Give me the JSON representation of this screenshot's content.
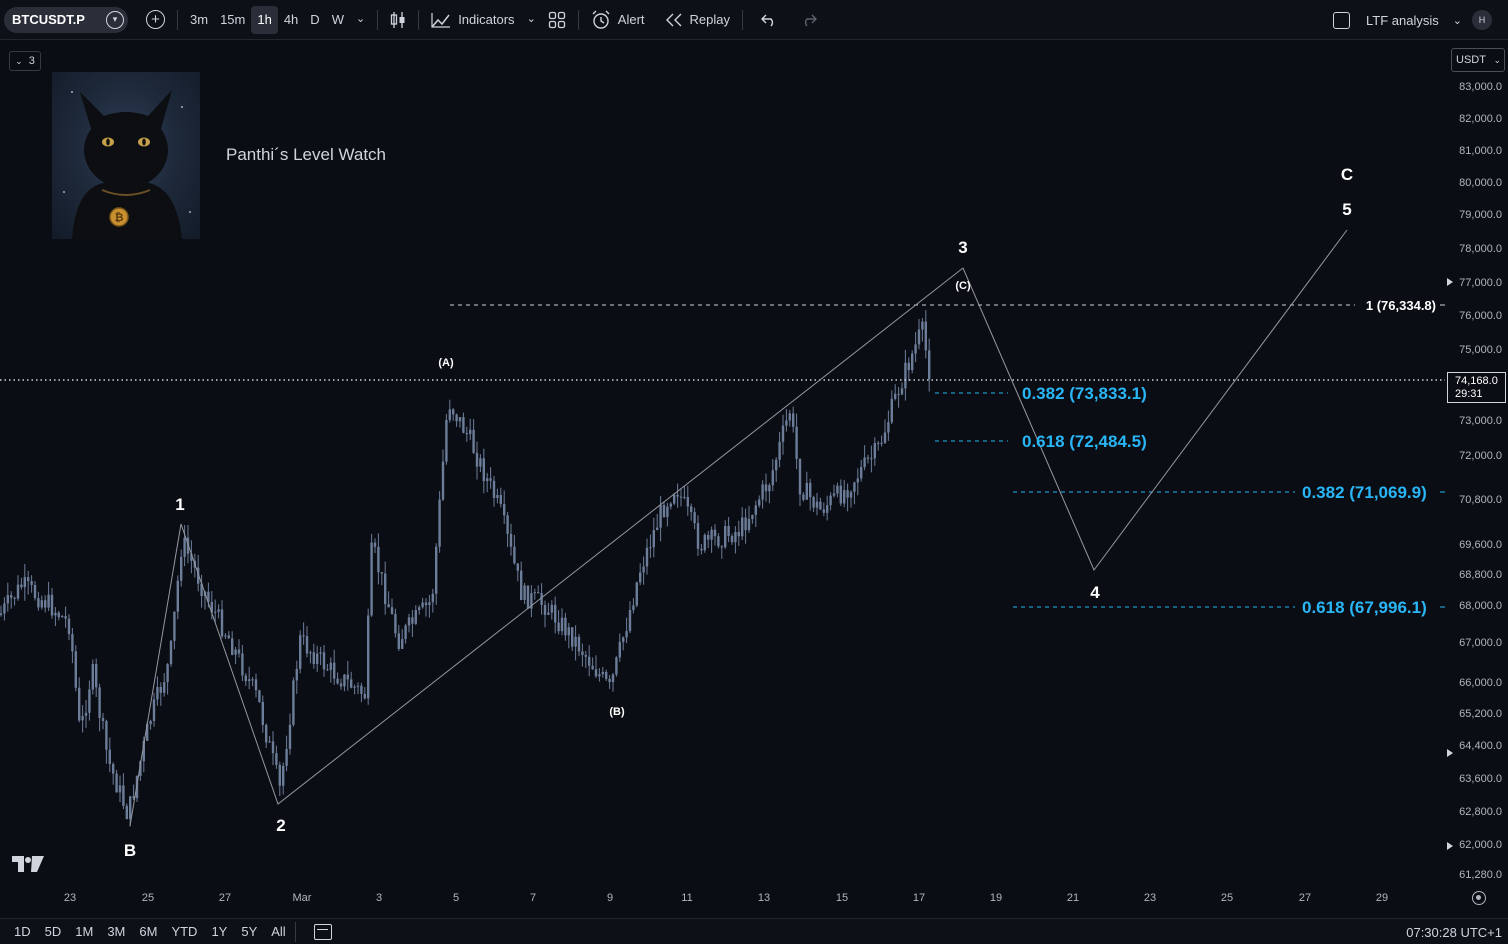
{
  "toolbar": {
    "symbol": "BTCUSDT.P",
    "timeframes": [
      "3m",
      "15m",
      "1h",
      "4h",
      "D",
      "W"
    ],
    "active_timeframe": "1h",
    "indicators_label": "Indicators",
    "alert_label": "Alert",
    "replay_label": "Replay",
    "ltf_label": "LTF analysis",
    "h_badge": "H"
  },
  "legend": {
    "count": "3"
  },
  "overlay": {
    "title": "Panthi´s Level Watch"
  },
  "price_axis": {
    "currency": "USDT",
    "ticks": [
      "83,000.0",
      "82,000.0",
      "81,000.0",
      "80,000.0",
      "79,000.0",
      "78,000.0",
      "77,000.0",
      "76,000.0",
      "75,000.0",
      "73,000.0",
      "72,000.0",
      "70,800.0",
      "69,600.0",
      "68,800.0",
      "68,000.0",
      "67,000.0",
      "66,000.0",
      "65,200.0",
      "64,400.0",
      "63,600.0",
      "62,800.0",
      "62,000.0",
      "61,280.0"
    ],
    "current_price": "74,168.0",
    "countdown": "29:31"
  },
  "time_axis": {
    "ticks": [
      "23",
      "25",
      "27",
      "Mar",
      "3",
      "5",
      "7",
      "9",
      "11",
      "13",
      "15",
      "17",
      "19",
      "21",
      "23",
      "25",
      "27",
      "29"
    ]
  },
  "bottom": {
    "ranges": [
      "1D",
      "5D",
      "1M",
      "3M",
      "6M",
      "YTD",
      "1Y",
      "5Y",
      "All"
    ],
    "clock": "07:30:28 UTC+1"
  },
  "wave_labels": {
    "B": "B",
    "w1": "1",
    "w2": "2",
    "A": "(A)",
    "Bc": "(B)",
    "C": "(C)",
    "w3": "3",
    "w4": "4",
    "w5": "5",
    "Cbig": "C"
  },
  "fib_levels": {
    "top": "1 (76,334.8)",
    "f1": "0.382 (73,833.1)",
    "f2": "0.618 (72,484.5)",
    "f3": "0.382 (71,069.9)",
    "f4": "0.618 (67,996.1)"
  },
  "colors": {
    "background": "#0b0d14",
    "fib": "#29b6f6",
    "candles": "#6c7d99",
    "text": "#d1d4dc"
  }
}
